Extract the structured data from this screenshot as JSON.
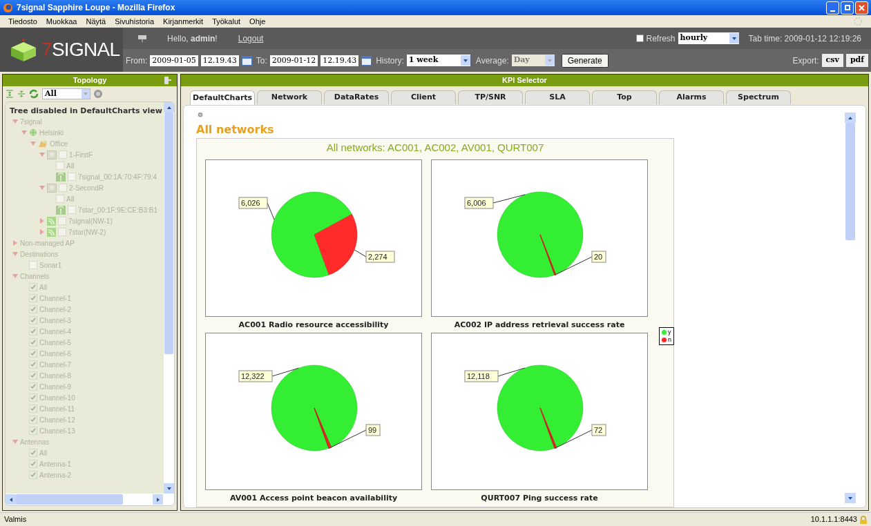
{
  "window": {
    "title": "7signal Sapphire Loupe - Mozilla Firefox"
  },
  "menu": [
    "Tiedosto",
    "Muokkaa",
    "Näytä",
    "Sivuhistoria",
    "Kirjanmerkit",
    "Työkalut",
    "Ohje"
  ],
  "header": {
    "logo": "7SIGNAL",
    "greeting": "Hello, **admin**!",
    "logout": "Logout",
    "refresh": {
      "label": "Refresh",
      "checked": false,
      "value": "hourly"
    },
    "tab_time": "Tab time: 2009-01-12 12:19:26",
    "from_label": "From:",
    "from_date": "2009-01-05",
    "from_time": "12.19.43",
    "to_label": "To:",
    "to_date": "2009-01-12",
    "to_time": "12.19.43",
    "history_label": "History:",
    "history": "1 week",
    "average_label": "Average:",
    "average": {
      "value": "Day",
      "disabled": true
    },
    "generate": "Generate",
    "export_label": "Export:",
    "export_buttons": [
      "csv",
      "pdf"
    ]
  },
  "topology": {
    "title": "Topology",
    "filter": "All",
    "notice": "Tree disabled in DefaultCharts view",
    "tree": [
      {
        "label": "7signal",
        "expanded": true,
        "children": [
          {
            "label": "Helsinki",
            "kind": "city",
            "expanded": true,
            "children": [
              {
                "label": "Office",
                "kind": "site",
                "expanded": true,
                "children": [
                  {
                    "label": "1-FirstF",
                    "kind": "floor",
                    "expanded": true,
                    "checked": false,
                    "children": [
                      {
                        "label": "All",
                        "kind": "item",
                        "checked": false
                      },
                      {
                        "label": "7signal_00:1A:70:4F:79:4",
                        "kind": "ap",
                        "checked": false
                      }
                    ]
                  },
                  {
                    "label": "2-SecondR",
                    "kind": "floor",
                    "expanded": true,
                    "checked": false,
                    "children": [
                      {
                        "label": "All",
                        "kind": "item",
                        "checked": false
                      },
                      {
                        "label": "7star_00:1F:9E:CE:B3:B1",
                        "kind": "ap",
                        "checked": false
                      }
                    ]
                  },
                  {
                    "label": "7signal(NW-1)",
                    "kind": "network",
                    "expanded": false,
                    "checked": false
                  },
                  {
                    "label": "7star(NW-2)",
                    "kind": "network",
                    "expanded": false,
                    "checked": false
                  }
                ]
              }
            ]
          }
        ]
      },
      {
        "label": "Non-managed AP",
        "expanded": false
      },
      {
        "label": "Destinations",
        "expanded": true,
        "children": [
          {
            "label": "Sonar1",
            "kind": "item",
            "checked": false
          }
        ]
      },
      {
        "label": "Channels",
        "expanded": true,
        "children": [
          {
            "label": "All",
            "kind": "item",
            "checked": true
          },
          {
            "label": "Channel-1",
            "kind": "item",
            "checked": true
          },
          {
            "label": "Channel-2",
            "kind": "item",
            "checked": true
          },
          {
            "label": "Channel-3",
            "kind": "item",
            "checked": true
          },
          {
            "label": "Channel-4",
            "kind": "item",
            "checked": true
          },
          {
            "label": "Channel-5",
            "kind": "item",
            "checked": true
          },
          {
            "label": "Channel-6",
            "kind": "item",
            "checked": true
          },
          {
            "label": "Channel-7",
            "kind": "item",
            "checked": true
          },
          {
            "label": "Channel-8",
            "kind": "item",
            "checked": true
          },
          {
            "label": "Channel-9",
            "kind": "item",
            "checked": true
          },
          {
            "label": "Channel-10",
            "kind": "item",
            "checked": true
          },
          {
            "label": "Channel-11",
            "kind": "item",
            "checked": true
          },
          {
            "label": "Channel-12",
            "kind": "item",
            "checked": true
          },
          {
            "label": "Channel-13",
            "kind": "item",
            "checked": true
          }
        ]
      },
      {
        "label": "Antennas",
        "expanded": true,
        "children": [
          {
            "label": "All",
            "kind": "item",
            "checked": true
          },
          {
            "label": "Antenna-1",
            "kind": "item",
            "checked": true
          },
          {
            "label": "Antenna-2",
            "kind": "item",
            "checked": true
          }
        ]
      }
    ]
  },
  "kpi": {
    "title": "KPI Selector",
    "tabs": [
      {
        "label": "DefaultCharts",
        "selected": true
      },
      {
        "label": "Network",
        "selected": false
      },
      {
        "label": "DataRates",
        "selected": false
      },
      {
        "label": "Client",
        "selected": false
      },
      {
        "label": "TP/SNR",
        "selected": false
      },
      {
        "label": "SLA",
        "selected": false
      },
      {
        "label": "Top",
        "selected": false
      },
      {
        "label": "Alarms",
        "selected": false
      },
      {
        "label": "Spectrum",
        "selected": false
      }
    ],
    "heading": "All networks",
    "charts_title": "All networks: AC001, AC002, AV001, QURT007",
    "legend": [
      {
        "label": "y",
        "color": "#33ee33"
      },
      {
        "label": "n",
        "color": "#ff2a2a"
      }
    ],
    "charts": [
      {
        "chart_data": {
          "type": "pie",
          "title": "AC001 Radio resource accessibility",
          "values": [
            6026,
            2274
          ],
          "value_labels": [
            "6,026",
            "2,274"
          ]
        }
      },
      {
        "chart_data": {
          "type": "pie",
          "title": "AC002 IP address retrieval success rate",
          "values": [
            6006,
            20
          ],
          "value_labels": [
            "6,006",
            "20"
          ]
        }
      },
      {
        "chart_data": {
          "type": "pie",
          "title": "AV001 Access point beacon availability",
          "values": [
            12322,
            99
          ],
          "value_labels": [
            "12,322",
            "99"
          ]
        }
      },
      {
        "chart_data": {
          "type": "pie",
          "title": "QURT007 Ping success rate",
          "values": [
            12118,
            72
          ],
          "value_labels": [
            "12,118",
            "72"
          ]
        }
      }
    ]
  },
  "status_bar": {
    "text": "Valmis",
    "address": "10.1.1.1:8443"
  }
}
